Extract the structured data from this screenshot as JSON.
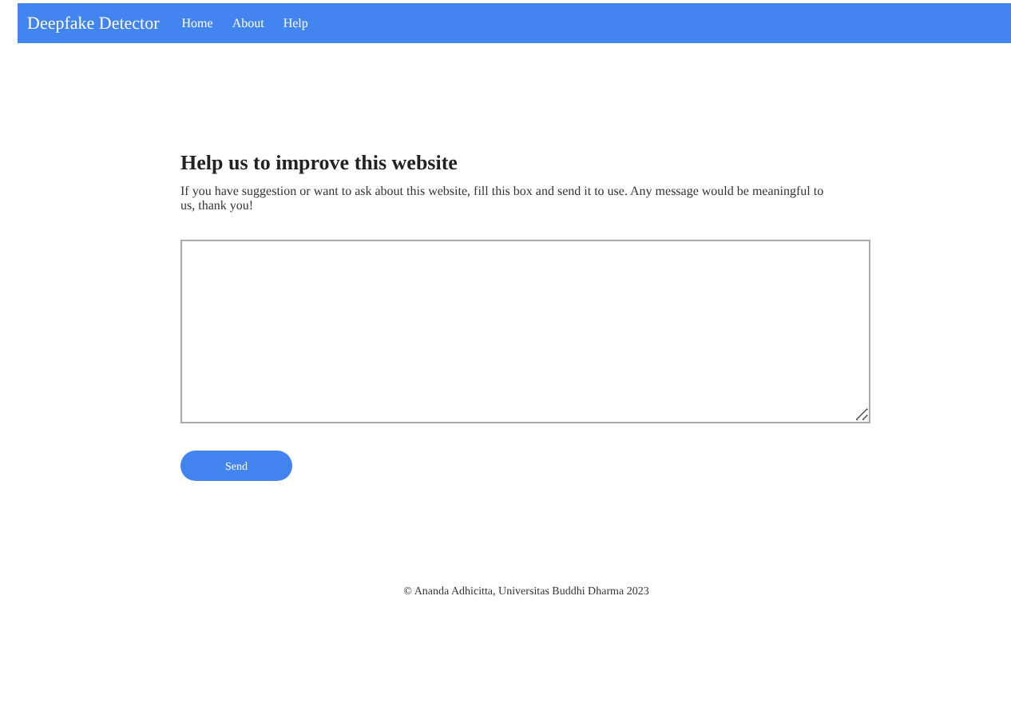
{
  "navbar": {
    "brand": "Deepfake Detector",
    "links": [
      "Home",
      "About",
      "Help"
    ]
  },
  "feedback": {
    "title": "Help us to improve this website",
    "description": "If you have suggestion or want to ask about this website, fill this box and send it to use. Any message would be meaningful to us, thank you!",
    "button": "Send"
  },
  "footer": "© Ananda Adhicitta, Universitas Buddhi Dharma 2023"
}
